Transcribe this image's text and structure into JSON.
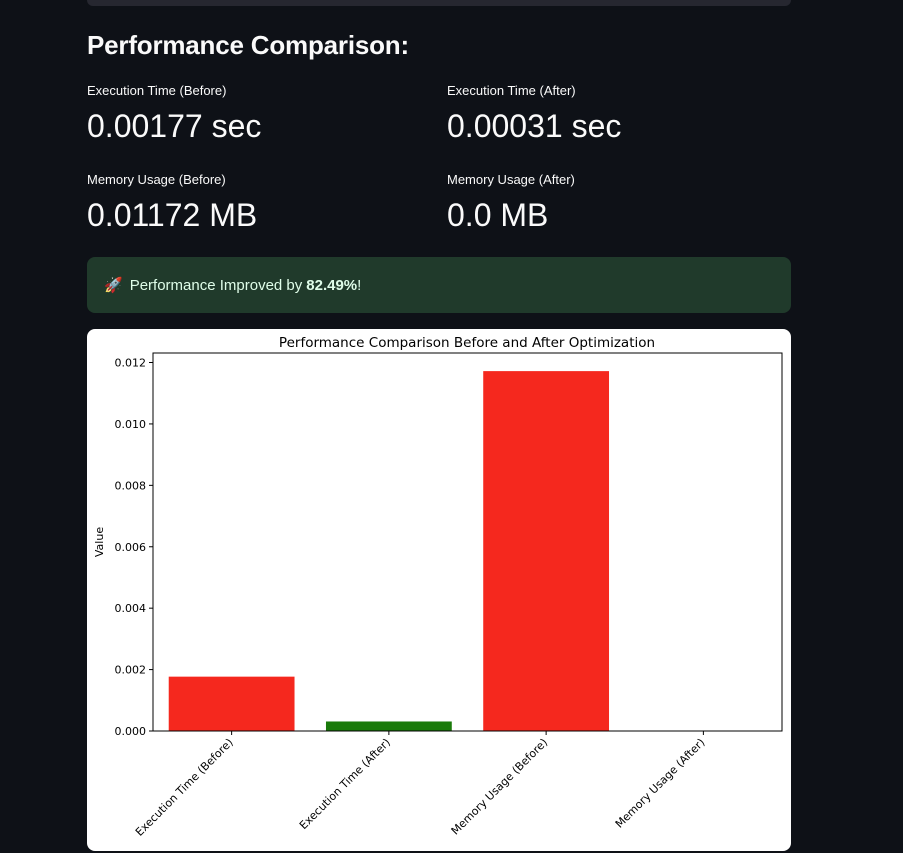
{
  "heading": "Performance Comparison:",
  "metrics": [
    {
      "label": "Execution Time (Before)",
      "value": "0.00177 sec"
    },
    {
      "label": "Execution Time (After)",
      "value": "0.00031 sec"
    },
    {
      "label": "Memory Usage (Before)",
      "value": "0.01172 MB"
    },
    {
      "label": "Memory Usage (After)",
      "value": "0.0 MB"
    }
  ],
  "alert": {
    "icon": "rocket-icon",
    "prefix": "Performance Improved by",
    "percent": "82.49%",
    "suffix": "!"
  },
  "colors": {
    "background": "#0e1117",
    "alert_bg": "#203a2b",
    "bar_red": "#f5281e",
    "bar_green": "#1a7a0a"
  },
  "chart_data": {
    "type": "bar",
    "title": "Performance Comparison Before and After Optimization",
    "xlabel": "",
    "ylabel": "Value",
    "categories": [
      "Execution Time (Before)",
      "Execution Time (After)",
      "Memory Usage (Before)",
      "Memory Usage (After)"
    ],
    "values": [
      0.00177,
      0.00031,
      0.01172,
      0.0
    ],
    "bar_colors": [
      "#f5281e",
      "#1a7a0a",
      "#f5281e",
      "#1a7a0a"
    ],
    "ylim": [
      0,
      0.01231
    ],
    "yticks": [
      0.0,
      0.002,
      0.004,
      0.006,
      0.008,
      0.01,
      0.012
    ],
    "ytick_labels": [
      "0.000",
      "0.002",
      "0.004",
      "0.006",
      "0.008",
      "0.010",
      "0.012"
    ],
    "grid": false,
    "legend": "none"
  }
}
